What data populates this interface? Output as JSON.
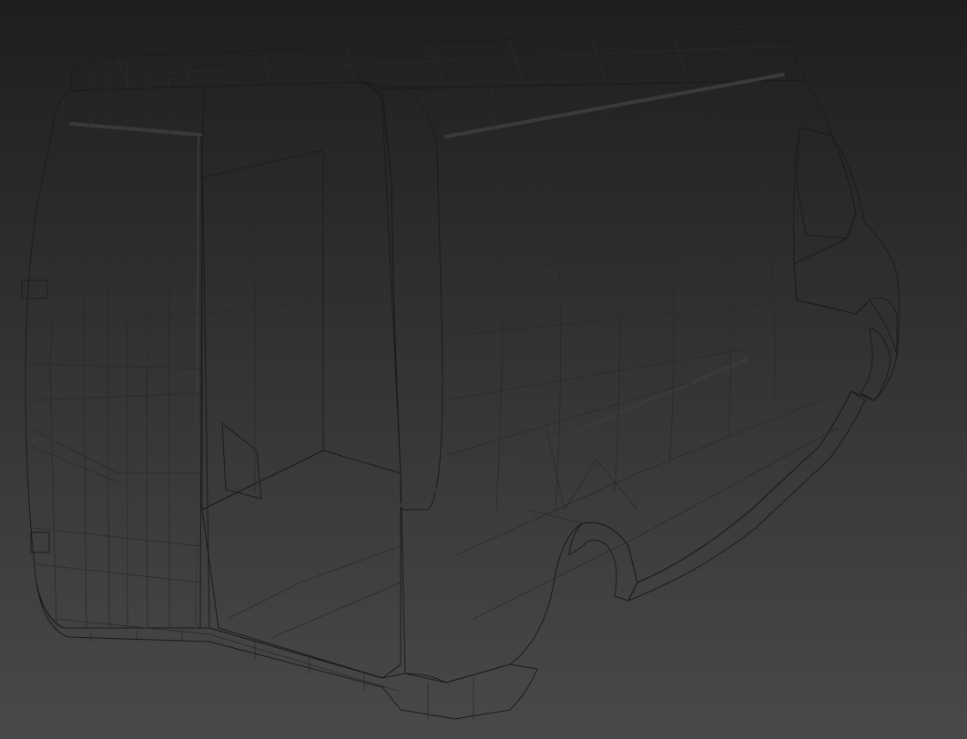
{
  "viewport": {
    "background_top": "#1e1e1e",
    "background_bottom": "#474747",
    "mesh_color": "#a9a9a9",
    "wire_color": "#1c1c1c"
  },
  "model": {
    "object": "van-body-mesh",
    "shading": "smooth-with-wireframe"
  }
}
